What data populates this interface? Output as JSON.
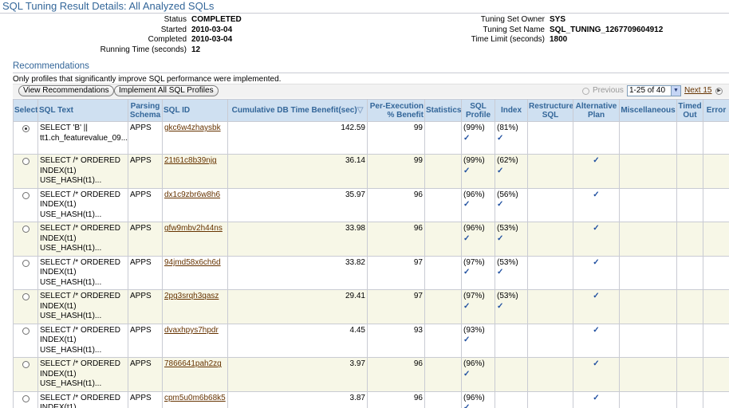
{
  "page_title": "SQL Tuning Result Details: All Analyzed SQLs",
  "summary_left": [
    {
      "label": "Status",
      "value": "COMPLETED"
    },
    {
      "label": "Started",
      "value": "2010-03-04"
    },
    {
      "label": "Completed",
      "value": "2010-03-04"
    },
    {
      "label": "Running Time (seconds)",
      "value": "12"
    }
  ],
  "summary_right": [
    {
      "label": "Tuning Set Owner",
      "value": "SYS"
    },
    {
      "label": "Tuning Set Name",
      "value": "SQL_TUNING_1267709604912"
    },
    {
      "label": "Time Limit (seconds)",
      "value": "1800"
    }
  ],
  "recommendations": {
    "title": "Recommendations",
    "note": "Only profiles that significantly improve SQL performance were implemented.",
    "view_button": "View Recommendations",
    "implement_button": "Implement All SQL Profiles",
    "previous": "Previous",
    "range": "1-25 of 40",
    "next": "Next 15"
  },
  "columns": {
    "select": "Select",
    "sql_text": "SQL Text",
    "schema": "Parsing Schema",
    "sql_id": "SQL ID",
    "benefit": "Cumulative DB Time Benefit(sec)",
    "per_exec": "Per-Execution % Benefit",
    "statistics": "Statistics",
    "sql_profile": "SQL Profile",
    "index": "Index",
    "restructure": "Restructure SQL",
    "alt_plan": "Alternative Plan",
    "misc": "Miscellaneous",
    "timed_out": "Timed Out",
    "error": "Error"
  },
  "check_glyph": "✓",
  "rows": [
    {
      "selected": true,
      "sql_text": [
        "SELECT 'B' ||",
        "tt1.ch_featurevalue_09..."
      ],
      "schema": "APPS",
      "sql_id": "gkc6w4zhaysbk",
      "benefit": "142.59",
      "per_exec": "99",
      "sql_profile": "(99%)",
      "index": "(81%)",
      "alt_plan": false
    },
    {
      "selected": false,
      "sql_text": [
        "SELECT /* ORDERED",
        "INDEX(t1)",
        "USE_HASH(t1)..."
      ],
      "schema": "APPS",
      "sql_id": "21t61c8b39njg",
      "benefit": "36.14",
      "per_exec": "99",
      "sql_profile": "(99%)",
      "index": "(62%)",
      "alt_plan": true
    },
    {
      "selected": false,
      "sql_text": [
        "SELECT /* ORDERED",
        "INDEX(t1)",
        "USE_HASH(t1)..."
      ],
      "schema": "APPS",
      "sql_id": "dx1c9zbr6w8h6",
      "benefit": "35.97",
      "per_exec": "96",
      "sql_profile": "(96%)",
      "index": "(56%)",
      "alt_plan": true
    },
    {
      "selected": false,
      "sql_text": [
        "SELECT /* ORDERED",
        "INDEX(t1)",
        "USE_HASH(t1)..."
      ],
      "schema": "APPS",
      "sql_id": "gfw9mbv2h44ns",
      "benefit": "33.98",
      "per_exec": "96",
      "sql_profile": "(96%)",
      "index": "(53%)",
      "alt_plan": true
    },
    {
      "selected": false,
      "sql_text": [
        "SELECT /* ORDERED",
        "INDEX(t1)",
        "USE_HASH(t1)..."
      ],
      "schema": "APPS",
      "sql_id": "94jmd58x6ch6d",
      "benefit": "33.82",
      "per_exec": "97",
      "sql_profile": "(97%)",
      "index": "(53%)",
      "alt_plan": true
    },
    {
      "selected": false,
      "sql_text": [
        "SELECT /* ORDERED",
        "INDEX(t1)",
        "USE_HASH(t1)..."
      ],
      "schema": "APPS",
      "sql_id": "2pg3srqh3qasz",
      "benefit": "29.41",
      "per_exec": "97",
      "sql_profile": "(97%)",
      "index": "(53%)",
      "alt_plan": true
    },
    {
      "selected": false,
      "sql_text": [
        "SELECT /* ORDERED",
        "INDEX(t1)",
        "USE_HASH(t1)..."
      ],
      "schema": "APPS",
      "sql_id": "dvaxhpys7hpdr",
      "benefit": "4.45",
      "per_exec": "93",
      "sql_profile": "(93%)",
      "index": "",
      "alt_plan": true
    },
    {
      "selected": false,
      "sql_text": [
        "SELECT /* ORDERED",
        "INDEX(t1)",
        "USE_HASH(t1)..."
      ],
      "schema": "APPS",
      "sql_id": "7866641pah2zg",
      "benefit": "3.97",
      "per_exec": "96",
      "sql_profile": "(96%)",
      "index": "",
      "alt_plan": true
    },
    {
      "selected": false,
      "sql_text": [
        "SELECT /* ORDERED",
        "INDEX(t1)",
        "USE_HASH(t1)..."
      ],
      "schema": "APPS",
      "sql_id": "cpm5u0m6b68k5",
      "benefit": "3.87",
      "per_exec": "96",
      "sql_profile": "(96%)",
      "index": "",
      "alt_plan": true
    }
  ]
}
